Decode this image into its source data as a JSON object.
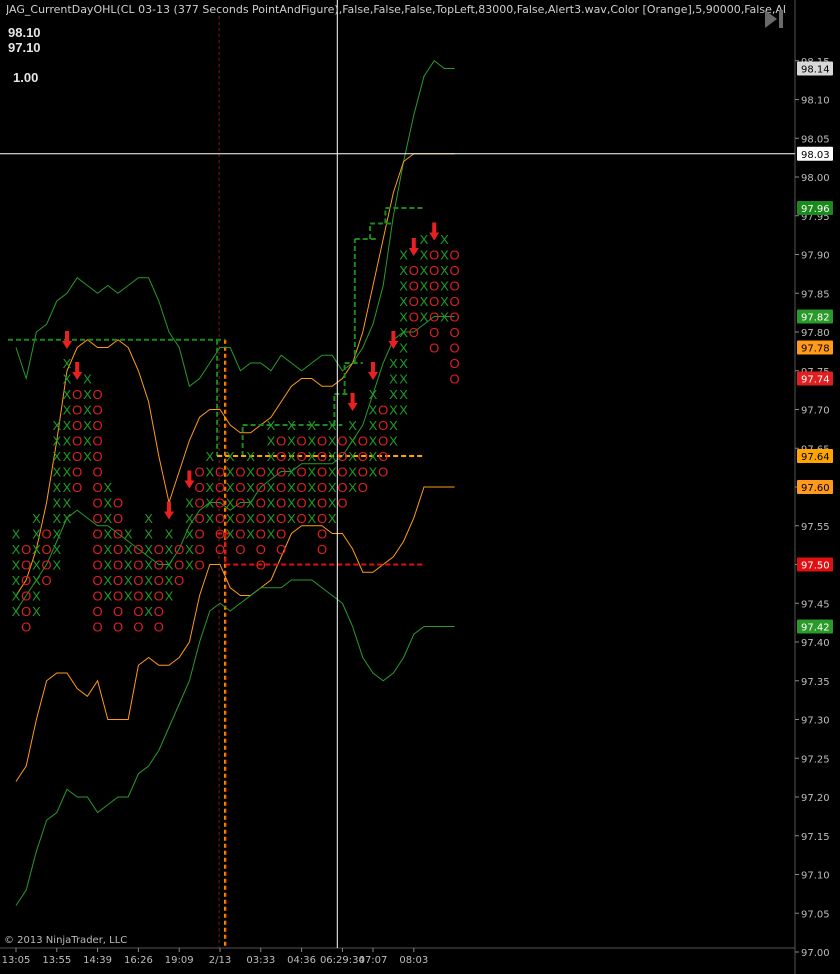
{
  "header": {
    "title": "JAG_CurrentDayOHL(CL 03-13 (377 Seconds PointAndFigure),False,False,False,TopLeft,83000,False,Alert3.wav,Color [Orange],5,90000,False,Alert3.wav,C",
    "box_values": [
      "98.10",
      "97.10",
      "1.00"
    ]
  },
  "footer": {
    "copyright": "© 2013 NinjaTrader, LLC"
  },
  "colors": {
    "background": "#000000",
    "x_mark": "#1f9e1f",
    "o_mark": "#e02020",
    "band_green": "#2a9a2a",
    "band_orange": "#ff9a1a",
    "level_green": "#1a8a1a",
    "level_orange": "#ffa500",
    "level_red": "#e01010",
    "crosshair": "#ffffff",
    "arrow": "#e82020"
  },
  "chart_data": {
    "type": "point-and-figure",
    "box_size": 0.02,
    "ylim": [
      97.0,
      98.2
    ],
    "y_ticks": [
      "98.15",
      "98.10",
      "98.05",
      "98.00",
      "97.95",
      "97.90",
      "97.85",
      "97.80",
      "97.75",
      "97.70",
      "97.65",
      "97.60",
      "97.55",
      "97.50",
      "97.45",
      "97.40",
      "97.35",
      "97.30",
      "97.25",
      "97.20",
      "97.15",
      "97.10",
      "97.05",
      "97.00"
    ],
    "x_labels": [
      {
        "label": "13:05",
        "col": 0
      },
      {
        "label": "13:55",
        "col": 4
      },
      {
        "label": "14:39",
        "col": 8
      },
      {
        "label": "16:26",
        "col": 12
      },
      {
        "label": "19:09",
        "col": 16
      },
      {
        "label": "2/13",
        "col": 20
      },
      {
        "label": "03:33",
        "col": 24
      },
      {
        "label": "04:36",
        "col": 28
      },
      {
        "label": "06:29:34",
        "col": 32
      },
      {
        "label": "07:07",
        "col": 35
      },
      {
        "label": "08:03",
        "col": 39
      }
    ],
    "columns": [
      {
        "type": "X",
        "low": 97.44,
        "high": 97.54
      },
      {
        "type": "O",
        "low": 97.42,
        "high": 97.52
      },
      {
        "type": "X",
        "low": 97.44,
        "high": 97.56
      },
      {
        "type": "O",
        "low": 97.48,
        "high": 97.54
      },
      {
        "type": "X",
        "low": 97.5,
        "high": 97.68
      },
      {
        "type": "X",
        "low": 97.56,
        "high": 97.76
      },
      {
        "type": "O",
        "low": 97.6,
        "high": 97.72
      },
      {
        "type": "X",
        "low": 97.64,
        "high": 97.74
      },
      {
        "type": "O",
        "low": 97.42,
        "high": 97.72
      },
      {
        "type": "X",
        "low": 97.46,
        "high": 97.6
      },
      {
        "type": "O",
        "low": 97.42,
        "high": 97.58
      },
      {
        "type": "X",
        "low": 97.46,
        "high": 97.54
      },
      {
        "type": "O",
        "low": 97.42,
        "high": 97.52
      },
      {
        "type": "X",
        "low": 97.44,
        "high": 97.56
      },
      {
        "type": "O",
        "low": 97.42,
        "high": 97.52
      },
      {
        "type": "X",
        "low": 97.46,
        "high": 97.54
      },
      {
        "type": "O",
        "low": 97.48,
        "high": 97.52
      },
      {
        "type": "X",
        "low": 97.5,
        "high": 97.58
      },
      {
        "type": "O",
        "low": 97.5,
        "high": 97.62
      },
      {
        "type": "X",
        "low": 97.56,
        "high": 97.64
      },
      {
        "type": "O",
        "low": 97.52,
        "high": 97.62
      },
      {
        "type": "X",
        "low": 97.54,
        "high": 97.64
      },
      {
        "type": "O",
        "low": 97.52,
        "high": 97.62
      },
      {
        "type": "X",
        "low": 97.54,
        "high": 97.64
      },
      {
        "type": "O",
        "low": 97.5,
        "high": 97.62
      },
      {
        "type": "X",
        "low": 97.54,
        "high": 97.68
      },
      {
        "type": "O",
        "low": 97.52,
        "high": 97.66
      },
      {
        "type": "X",
        "low": 97.56,
        "high": 97.68
      },
      {
        "type": "O",
        "low": 97.56,
        "high": 97.66
      },
      {
        "type": "X",
        "low": 97.56,
        "high": 97.68
      },
      {
        "type": "O",
        "low": 97.52,
        "high": 97.66
      },
      {
        "type": "X",
        "low": 97.56,
        "high": 97.68
      },
      {
        "type": "O",
        "low": 97.58,
        "high": 97.66
      },
      {
        "type": "X",
        "low": 97.6,
        "high": 97.68
      },
      {
        "type": "O",
        "low": 97.6,
        "high": 97.66
      },
      {
        "type": "X",
        "low": 97.62,
        "high": 97.72
      },
      {
        "type": "O",
        "low": 97.62,
        "high": 97.7
      },
      {
        "type": "X",
        "low": 97.66,
        "high": 97.76
      },
      {
        "type": "X",
        "low": 97.7,
        "high": 97.9
      },
      {
        "type": "O",
        "low": 97.8,
        "high": 97.88
      },
      {
        "type": "X",
        "low": 97.82,
        "high": 97.92
      },
      {
        "type": "O",
        "low": 97.78,
        "high": 97.9
      },
      {
        "type": "X",
        "low": 97.82,
        "high": 97.92
      },
      {
        "type": "O",
        "low": 97.74,
        "high": 97.9
      }
    ],
    "signal_arrows": [
      5,
      6,
      15,
      17,
      33,
      35,
      37,
      39,
      41
    ],
    "series": [
      {
        "role": "outer_upper",
        "color": "green",
        "values": [
          97.78,
          97.74,
          97.8,
          97.81,
          97.84,
          97.85,
          97.87,
          97.86,
          97.85,
          97.86,
          97.85,
          97.86,
          97.87,
          97.87,
          97.84,
          97.8,
          97.78,
          97.73,
          97.74,
          97.76,
          97.78,
          97.78,
          97.75,
          97.76,
          97.76,
          97.75,
          97.77,
          97.76,
          97.75,
          97.76,
          97.77,
          97.77,
          97.75,
          97.76,
          97.78,
          97.81,
          97.86,
          97.95,
          98.02,
          98.08,
          98.13,
          98.15,
          98.14,
          98.14
        ]
      },
      {
        "role": "inner_upper",
        "color": "orange",
        "values": [
          97.46,
          97.48,
          97.52,
          97.58,
          97.66,
          97.75,
          97.78,
          97.79,
          97.78,
          97.78,
          97.79,
          97.78,
          97.75,
          97.71,
          97.64,
          97.58,
          97.62,
          97.66,
          97.69,
          97.7,
          97.7,
          97.68,
          97.67,
          97.67,
          97.68,
          97.69,
          97.71,
          97.73,
          97.74,
          97.74,
          97.73,
          97.73,
          97.74,
          97.76,
          97.8,
          97.86,
          97.92,
          97.98,
          98.02,
          98.03,
          98.03,
          98.03,
          98.03,
          98.03
        ]
      },
      {
        "role": "middle",
        "color": "green",
        "values": [
          97.44,
          97.46,
          97.48,
          97.5,
          97.53,
          97.56,
          97.57,
          97.56,
          97.55,
          97.55,
          97.54,
          97.53,
          97.52,
          97.51,
          97.5,
          97.5,
          97.52,
          97.55,
          97.57,
          97.58,
          97.58,
          97.57,
          97.58,
          97.58,
          97.6,
          97.61,
          97.62,
          97.62,
          97.63,
          97.63,
          97.63,
          97.63,
          97.64,
          97.66,
          97.68,
          97.72,
          97.76,
          97.79,
          97.8,
          97.8,
          97.81,
          97.82,
          97.82,
          97.82
        ]
      },
      {
        "role": "inner_lower",
        "color": "orange",
        "values": [
          97.22,
          97.24,
          97.3,
          97.35,
          97.36,
          97.36,
          97.34,
          97.33,
          97.35,
          97.3,
          97.3,
          97.3,
          97.37,
          97.38,
          97.37,
          97.37,
          97.38,
          97.4,
          97.46,
          97.5,
          97.5,
          97.47,
          97.46,
          97.46,
          97.47,
          97.48,
          97.51,
          97.54,
          97.55,
          97.55,
          97.55,
          97.54,
          97.54,
          97.52,
          97.49,
          97.49,
          97.5,
          97.51,
          97.53,
          97.56,
          97.6,
          97.6,
          97.6,
          97.6
        ]
      },
      {
        "role": "outer_lower",
        "color": "green",
        "values": [
          97.06,
          97.08,
          97.13,
          97.17,
          97.18,
          97.21,
          97.2,
          97.2,
          97.18,
          97.19,
          97.2,
          97.2,
          97.23,
          97.24,
          97.26,
          97.29,
          97.32,
          97.35,
          97.4,
          97.44,
          97.45,
          97.44,
          97.45,
          97.46,
          97.47,
          97.47,
          97.47,
          97.48,
          97.48,
          97.48,
          97.47,
          97.46,
          97.45,
          97.42,
          97.38,
          97.36,
          97.35,
          97.36,
          97.38,
          97.41,
          97.42,
          97.42,
          97.42,
          97.42
        ]
      }
    ],
    "level_lines": [
      {
        "color": "green",
        "dash": true,
        "price": 97.79,
        "x_start_col": 0,
        "x_end_col": 20.5
      },
      {
        "color": "green",
        "dash": true,
        "price": 97.64,
        "x_start_col": 20.5,
        "x_end_col": 23
      },
      {
        "color": "green",
        "dash": true,
        "price": 97.68,
        "x_start_col": 23,
        "x_end_col": 32
      },
      {
        "color": "green",
        "dash": true,
        "price": 97.72,
        "x_start_col": 32,
        "x_end_col": 33
      },
      {
        "color": "green",
        "dash": true,
        "price": 97.76,
        "x_start_col": 33,
        "x_end_col": 34
      },
      {
        "color": "green",
        "dash": true,
        "price": 97.92,
        "x_start_col": 34,
        "x_end_col": 35.5
      },
      {
        "color": "green",
        "dash": true,
        "price": 97.94,
        "x_start_col": 35.5,
        "x_end_col": 37
      },
      {
        "color": "green",
        "dash": true,
        "price": 97.96,
        "x_start_col": 37,
        "x_end_col": 40
      },
      {
        "color": "orange",
        "dash": true,
        "price": 97.64,
        "x_start_col": 20.5,
        "x_end_col": 40
      },
      {
        "color": "red",
        "dash": true,
        "price": 97.54,
        "x_start_col": 20.5,
        "x_end_col": 21.3
      },
      {
        "color": "red",
        "dash": true,
        "price": 97.5,
        "x_start_col": 21.3,
        "x_end_col": 40
      }
    ],
    "price_tags": [
      {
        "label": "98.14",
        "bg": "#d8d8d8",
        "fg": "#000"
      },
      {
        "label": "98.03",
        "bg": "#ffffff",
        "fg": "#000"
      },
      {
        "label": "97.96",
        "bg": "#1a8a1a",
        "fg": "#fff"
      },
      {
        "label": "97.82",
        "bg": "#2a9a2a",
        "fg": "#fff"
      },
      {
        "label": "97.78",
        "bg": "#ff9a1a",
        "fg": "#000"
      },
      {
        "label": "97.74",
        "bg": "#e02020",
        "fg": "#fff"
      },
      {
        "label": "97.64",
        "bg": "#ffa500",
        "fg": "#000"
      },
      {
        "label": "97.60",
        "bg": "#ff9a1a",
        "fg": "#000"
      },
      {
        "label": "97.50",
        "bg": "#e01010",
        "fg": "#fff"
      },
      {
        "label": "97.42",
        "bg": "#2a9a2a",
        "fg": "#fff"
      }
    ],
    "crosshair": {
      "price": 98.03,
      "col": 31.5
    },
    "session_break_col": 20.5
  }
}
